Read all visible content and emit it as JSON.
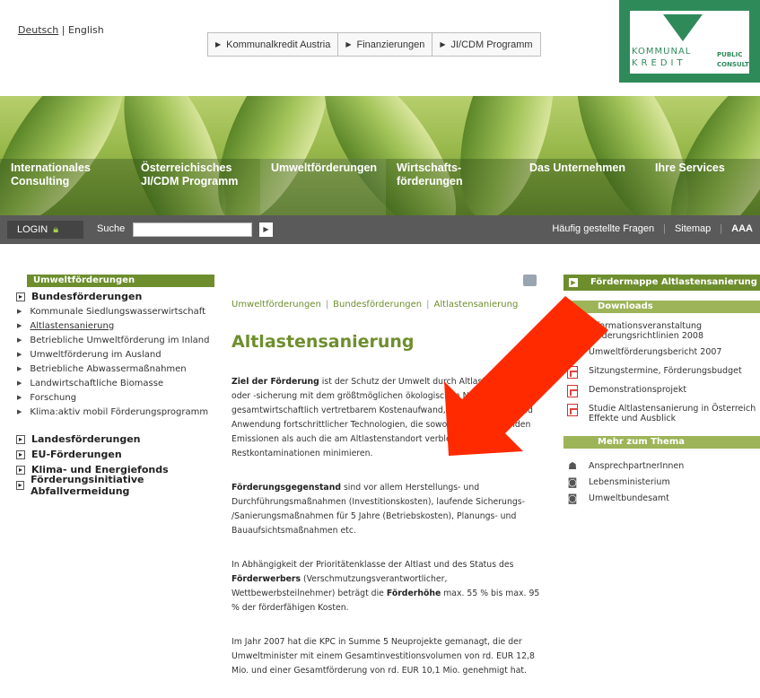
{
  "lang": {
    "deutsch": "Deutsch",
    "sep": "|",
    "english": "English"
  },
  "topnav": [
    "Kommunalkredit Austria",
    "Finanzierungen",
    "JI/CDM Programm"
  ],
  "logo": {
    "line1": "KOMMUNAL",
    "line2": "KREDIT",
    "pc1": "PUBLIC",
    "pc2": "CONSULTING",
    "color": "#2f8a5a"
  },
  "mainnav": [
    {
      "l1": "Internationales",
      "l2": "Consulting"
    },
    {
      "l1": "Österreichisches",
      "l2": "JI/CDM Programm"
    },
    {
      "l1": "Umweltförderungen",
      "l2": ""
    },
    {
      "l1": "Wirtschafts-",
      "l2": "förderungen"
    },
    {
      "l1": "Das Unternehmen",
      "l2": ""
    },
    {
      "l1": "Ihre Services",
      "l2": ""
    }
  ],
  "toolbar": {
    "login": "LOGIN",
    "search_label": "Suche",
    "faq": "Häufig gestellte Fragen",
    "sitemap": "Sitemap",
    "textsize": "AAA"
  },
  "leftnav": {
    "header": "Umweltförderungen",
    "bund": "Bundesförderungen",
    "sub": [
      "Kommunale Siedlungswasserwirtschaft",
      "Altlastensanierung",
      "Betriebliche Umweltförderung im Inland",
      "Umweltförderung im Ausland",
      "Betriebliche Abwassermaßnahmen",
      "Landwirtschaftliche Biomasse",
      "Forschung",
      "Klima:aktiv mobil Förderungsprogramm"
    ],
    "more": [
      "Landesförderungen",
      "EU-Förderungen",
      "Klima- und Energiefonds",
      "Förderungsinitiative Abfallvermeidung"
    ]
  },
  "breadcrumb": [
    "Umweltförderungen",
    "Bundesförderungen",
    "Altlastensanierung"
  ],
  "title": "Altlastensanierung",
  "p1": {
    "bold": "Ziel der Förderung",
    "text": "ist der Schutz der Umwelt durch Altlastensanierung oder -sicherung mit dem größtmöglichen ökologischen Nutzen unter gesamtwirtschaftlich vertretbarem Kostenaufwand, die Entwicklung und Anwendung fortschrittlicher Technologien, die sowohl die entstehenden Emissionen als auch die am Altlastenstandort verbleibenden Restkontaminationen minimieren."
  },
  "p2": {
    "bold": "Förderungsgegenstand",
    "text": "sind vor allem Herstellungs- und Durchführungsmaßnahmen (Investitionskosten), laufende Sicherungs- /Sanierungsmaßnahmen für 5 Jahre (Betriebskosten), Planungs- und Bauaufsichtsmaßnahmen etc."
  },
  "p3": {
    "a": "In Abhängigkeit der Prioritätenklasse der Altlast und des Status des",
    "b1": "Förderwerbers",
    "b": "(Verschmutzungsverantwortlicher, Wettbewerbsteilnehmer) beträgt die",
    "b2": "Förderhöhe",
    "c": "max. 55 % bis max. 95 % der förderfähigen Kosten."
  },
  "p4": "Im Jahr 2007 hat die KPC in Summe 5 Neuprojekte gemanagt, die der Umweltminister mit einem Gesamtinvestitionsvolumen von rd. EUR 12,8 Mio. und einer Gesamtförderung von rd. EUR 10,1 Mio. genehmigt hat.",
  "right": {
    "foerdermappe": "Fördermappe Altlastensanierung",
    "downloads": "Downloads",
    "dl": [
      "Informationsveranstaltung Förderungsrichtlinien 2008",
      "Umweltförderungsbericht 2007",
      "Sitzungstermine, Förderungsbudget",
      "Demonstrationsprojekt",
      "Studie Altlastensanierung in Österreich Effekte und Ausblick"
    ],
    "mehr": "Mehr zum Thema",
    "links": [
      "AnsprechpartnerInnen",
      "Lebensministerium",
      "Umweltbundesamt"
    ]
  },
  "colors": {
    "green": "#6e8e2e",
    "arrow": "#ff2a00",
    "toolbar": "#5a5a5a"
  }
}
